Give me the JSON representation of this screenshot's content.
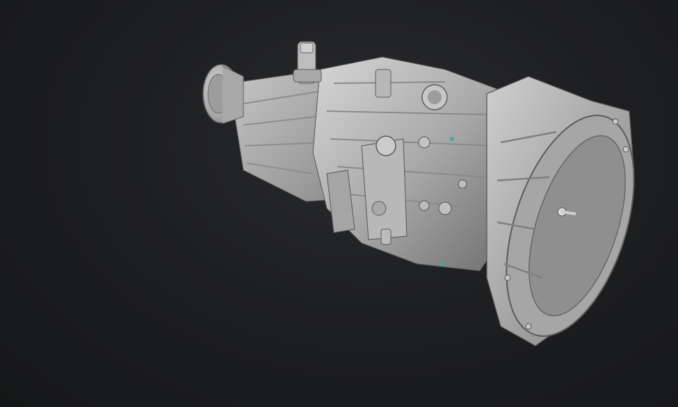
{
  "scene": {
    "background_color": "#1b1c1e",
    "model_color": "#b4b4b4",
    "model_shadow_color": "#6e6e6e",
    "model_highlight_color": "#dcdcdc",
    "accent_color": "#4aa7a0",
    "subject": "gearbox-3d-model"
  }
}
